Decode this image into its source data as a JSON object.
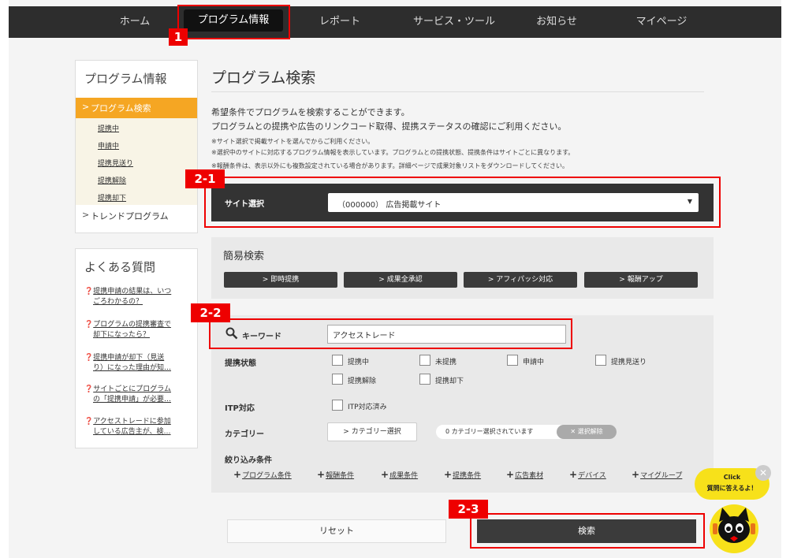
{
  "nav": {
    "items": [
      "ホーム",
      "プログラム情報",
      "レポート",
      "サービス・ツール",
      "お知らせ",
      "マイページ"
    ]
  },
  "tags": {
    "t1": "1",
    "t21": "2-1",
    "t22": "2-2",
    "t23": "2-3"
  },
  "sidebar": {
    "title": "プログラム情報",
    "active": "プログラム検索",
    "subitems": [
      "提携中",
      "申請中",
      "提携見送り",
      "提携解除",
      "提携却下"
    ],
    "trend": "トレンドプログラム"
  },
  "faq": {
    "title": "よくある質問",
    "items": [
      [
        "提携申請の結果は、いつ",
        "ごろわかるの？"
      ],
      [
        "プログラムの提携審査で",
        "却下になったら？"
      ],
      [
        "提携申請が却下（見送",
        "り）になった理由が知…"
      ],
      [
        "サイトごとにプログラム",
        "の「提携申請」が必要…"
      ],
      [
        "アクセストレードに参加",
        "している広告主が、検…"
      ]
    ]
  },
  "main": {
    "title": "プログラム検索",
    "desc1": "希望条件でプログラムを検索することができます。",
    "desc2": "プログラムとの提携や広告のリンクコード取得、提携ステータスの確認にご利用ください。",
    "note1": "※サイト選択で掲載サイトを選んでからご利用ください。",
    "note2": "※選択中のサイトに対応するプログラム情報を表示しています。プログラムとの提携状態、提携条件はサイトごとに異なります。",
    "note3": "※報酬条件は、表示以外にも複数設定されている場合があります。詳細ページで成果対象リストをダウンロードしてください。"
  },
  "site_select": {
    "label": "サイト選択",
    "value": "（000000） 広告掲載サイト"
  },
  "quick": {
    "title": "簡易検索",
    "buttons": [
      "即時提携",
      "成果全承認",
      "アフィパッシ対応",
      "報酬アップ"
    ]
  },
  "keyword": {
    "label": "キーワード",
    "value": "アクセストレード"
  },
  "status": {
    "label": "提携状態",
    "options": [
      "提携中",
      "未提携",
      "申請中",
      "提携見送り",
      "提携解除",
      "提携却下"
    ]
  },
  "itp": {
    "label": "ITP対応",
    "option": "ITP対応済み"
  },
  "category": {
    "label": "カテゴリー",
    "button": "カテゴリー選択",
    "selected": "0 カテゴリー選択されています",
    "clear": "選択解除"
  },
  "filters": {
    "label": "絞り込み条件",
    "items": [
      "プログラム条件",
      "報酬条件",
      "成果条件",
      "提携条件",
      "広告素材",
      "デバイス",
      "マイグループ"
    ]
  },
  "actions": {
    "reset": "リセット",
    "search": "検索"
  },
  "helper": {
    "line1": "Click",
    "line2": "質問に答えるよ！"
  },
  "colors": {
    "accent": "#f5a623",
    "highlight": "#e00000",
    "nav_bg": "#2d2d2d"
  }
}
